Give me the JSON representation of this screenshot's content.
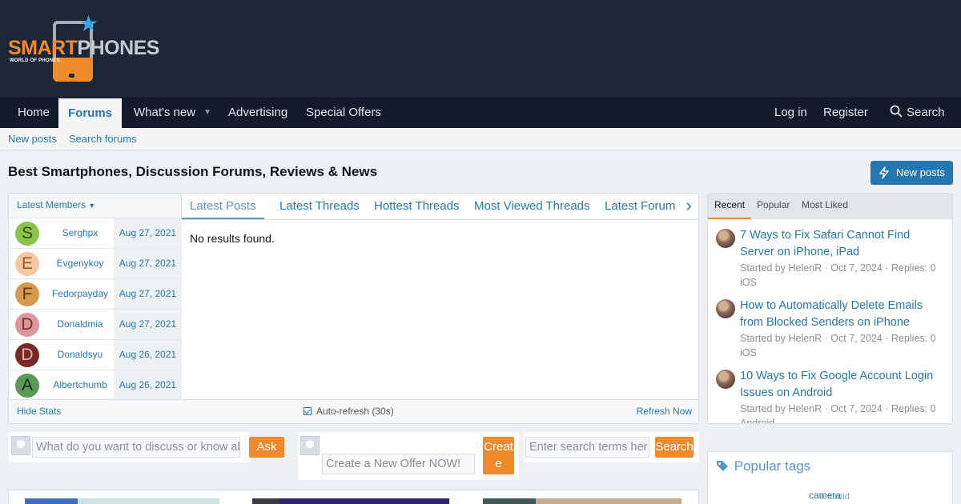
{
  "logo": {
    "word_orange": "SMART",
    "word_gray": "PHONES",
    "tagline": "WORLD OF PHONES"
  },
  "nav": {
    "items": [
      "Home",
      "Forums",
      "What's new",
      "Advertising",
      "Special Offers"
    ],
    "active": "Forums",
    "login": "Log in",
    "register": "Register",
    "search": "Search"
  },
  "subnav": {
    "items": [
      "New posts",
      "Search forums"
    ]
  },
  "page": {
    "title": "Best Smartphones, Discussion Forums, Reviews & News",
    "new_posts_button": "New posts"
  },
  "stats": {
    "members_header": "Latest Members",
    "members": [
      {
        "initial": "S",
        "name": "Serghpx",
        "date": "Aug 27, 2021",
        "bg": "#8bc34a",
        "fg": "#2e4d12"
      },
      {
        "initial": "E",
        "name": "Evgenykoy",
        "date": "Aug 27, 2021",
        "bg": "#f3c7a1",
        "fg": "#9a5a2a"
      },
      {
        "initial": "F",
        "name": "Fedorpayday",
        "date": "Aug 27, 2021",
        "bg": "#d69a4c",
        "fg": "#5c3a10"
      },
      {
        "initial": "D",
        "name": "Donaldmia",
        "date": "Aug 27, 2021",
        "bg": "#d9999c",
        "fg": "#7a3034"
      },
      {
        "initial": "D",
        "name": "Donaldsyu",
        "date": "Aug 26, 2021",
        "bg": "#7a2a26",
        "fg": "#e7b1ad"
      },
      {
        "initial": "A",
        "name": "Albertchumb",
        "date": "Aug 26, 2021",
        "bg": "#5a9a57",
        "fg": "#123012"
      }
    ],
    "tabs": [
      "Latest Posts",
      "Latest Threads",
      "Hottest Threads",
      "Most Viewed Threads",
      "Latest Forum N"
    ],
    "active_tab": "Latest Posts",
    "empty_message": "No results found.",
    "hide_stats": "Hide Stats",
    "auto_refresh": "Auto-refresh (30s)",
    "refresh_now": "Refresh Now"
  },
  "widgets": {
    "ask_placeholder": "What do you want to discuss or know ab",
    "ask_button": "Ask",
    "offer_placeholder": "Create a New Offer NOW!",
    "offer_button_line1": "Creat",
    "offer_button_line2": "e",
    "search_placeholder": "Enter search terms her",
    "search_button": "Search"
  },
  "sidebar": {
    "tabs": [
      "Recent",
      "Popular",
      "Most Liked"
    ],
    "active_tab": "Recent",
    "posts": [
      {
        "title": "7 Ways to Fix Safari Cannot Find Server on iPhone, iPad",
        "meta": "Started by HelenR · Oct 7, 2024 · Replies: 0",
        "forum": "iOS"
      },
      {
        "title": "How to Automatically Delete Emails from Blocked Senders on iPhone",
        "meta": "Started by HelenR · Oct 7, 2024 · Replies: 0",
        "forum": "iOS"
      },
      {
        "title": "10 Ways to Fix Google Account Login Issues on Android",
        "meta": "Started by HelenR · Oct 7, 2024 · Replies: 0",
        "forum": "Android"
      }
    ],
    "popular_tags_title": "Popular tags",
    "tags": [
      "camera",
      "android"
    ]
  },
  "colors": {
    "header_bg": "#1c2637",
    "nav_bg": "#121b29",
    "link": "#2577b1",
    "accent_orange": "#ef8a2c"
  }
}
